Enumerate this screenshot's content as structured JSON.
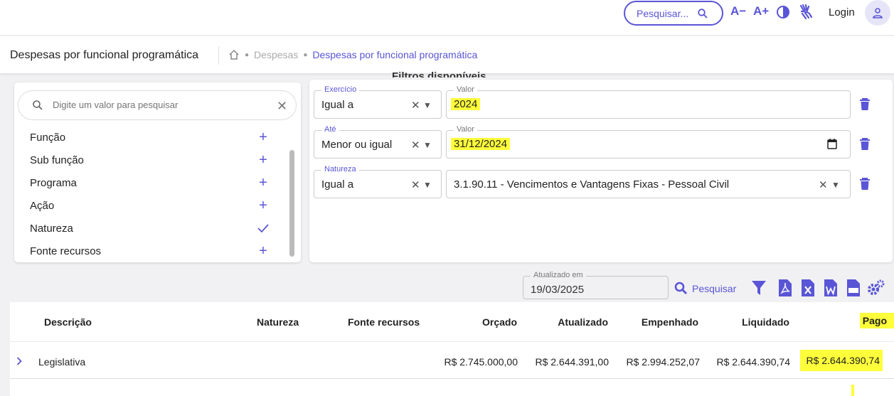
{
  "topbar": {
    "search_placeholder": "Pesquisar...",
    "font_decrease": "A−",
    "font_increase": "A+",
    "login_label": "Login"
  },
  "titlebar": {
    "page_title": "Despesas por funcional programática",
    "breadcrumb": {
      "items": [
        "Despesas",
        "Despesas por funcional programática"
      ]
    }
  },
  "filters_title": "Filtros disponíveis",
  "left_panel": {
    "search_placeholder": "Digite um valor para pesquisar",
    "items": [
      {
        "label": "Função",
        "action": "plus"
      },
      {
        "label": "Sub função",
        "action": "plus"
      },
      {
        "label": "Programa",
        "action": "plus"
      },
      {
        "label": "Ação",
        "action": "plus"
      },
      {
        "label": "Natureza",
        "action": "check"
      },
      {
        "label": "Fonte recursos",
        "action": "plus"
      }
    ]
  },
  "filters": [
    {
      "field_label": "Exercício",
      "operator": "Igual a",
      "value_label": "Valor",
      "value": "2024"
    },
    {
      "field_label": "Até",
      "operator": "Menor ou igual",
      "value_label": "Valor",
      "value": "31/12/2024"
    },
    {
      "field_label": "Natureza",
      "operator": "Igual a",
      "value_label": "",
      "value": "3.1.90.11 - Vencimentos e Vantagens Fixas - Pessoal Civil"
    }
  ],
  "toolbar": {
    "updated_label": "Atualizado em",
    "updated_value": "19/03/2025",
    "search_button": "Pesquisar"
  },
  "table": {
    "headers": [
      "Descrição",
      "Natureza",
      "Fonte recursos",
      "Orçado",
      "Atualizado",
      "Empenhado",
      "Liquidado",
      "Pago"
    ],
    "rows": [
      {
        "descricao": "Legislativa",
        "natureza": "",
        "fonte": "",
        "orcado": "R$ 2.745.000,00",
        "atualizado": "R$ 2.644.391,00",
        "empenhado": "R$ 2.994.252,07",
        "liquidado": "R$ 2.644.390,74",
        "pago": "R$ 2.644.390,74"
      }
    ]
  },
  "colors": {
    "accent": "#5a55d6",
    "highlight": "#fefe3a"
  }
}
